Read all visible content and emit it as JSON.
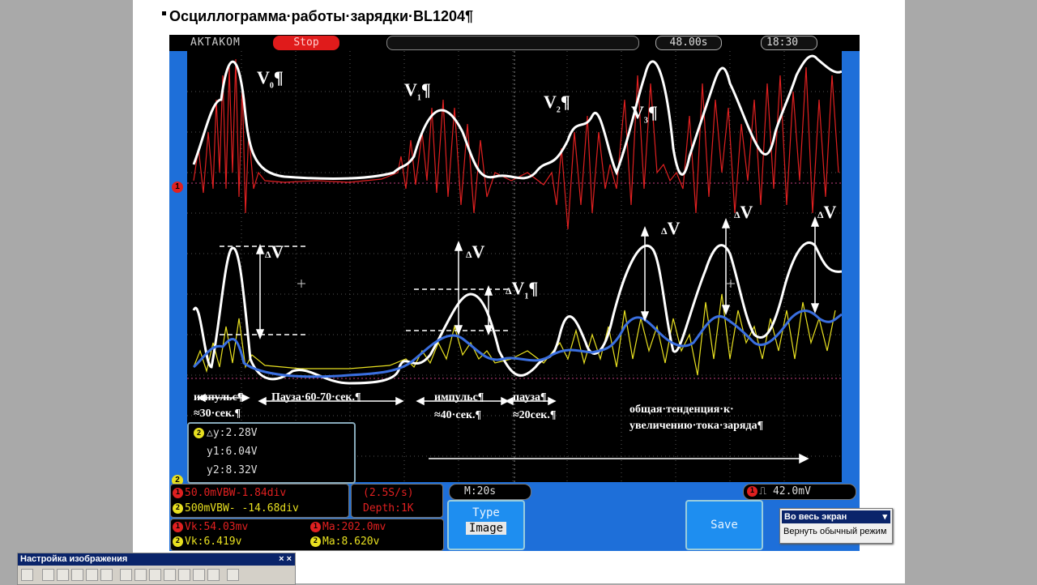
{
  "document": {
    "heading": "Осциллограмма·работы·зарядки·BL1204¶"
  },
  "scope": {
    "brand": "AKTAKOM",
    "run_state": "Stop",
    "timer": "48.00s",
    "clock": "18:30",
    "channel1_marker": "1",
    "channel2_marker": "2",
    "cursor": {
      "dy": "△y:2.28V",
      "y1": "y1:6.04V",
      "y2": "y2:8.32V"
    },
    "ch1_scale": "50.0mVBW-1.84div",
    "ch2_scale": "500mVBW- -14.68div",
    "sample_rate": "(2.5S/s)",
    "depth": "Depth:1K",
    "timebase": "M:20s",
    "trigger_level": "42.0mV",
    "vk1": "Vk:54.03mv",
    "vk2": "Vk:6.419v",
    "ma1": "Ma:202.0mv",
    "ma2": "Ma:8.620v",
    "type_label": "Type",
    "type_value": "Image",
    "save_label": "Save"
  },
  "annotations": {
    "v0": "V",
    "v0_sub": "0",
    "v1": "V",
    "v1_sub": "1",
    "v2": "V",
    "v2_sub": "2",
    "v3": "V",
    "v3_sub": "3",
    "pilcrow": "¶",
    "delta": "Δ",
    "dv": "V",
    "dv1": "V",
    "dv1_sub": "1",
    "impulse1": "импульс¶",
    "impulse1_time": "≈30·сек.¶",
    "pause1": "Пауза·60-70·сек.¶",
    "impulse2": "импульс¶",
    "impulse2_time": "≈40·сек.¶",
    "pause2": "пауза¶",
    "pause2_time": "≈20сек.¶",
    "trend1": "общая·тенденция·к·",
    "trend2": "увеличению·тока·заряда¶"
  },
  "context_menu": {
    "title": "Во весь экран",
    "item": "Вернуть обычный режим"
  },
  "picture_toolbar": {
    "title": "Настройка изображения",
    "close": "× ×"
  },
  "colors": {
    "scope_frame": "#1e6fd9",
    "ch1": "#e02020",
    "ch2": "#e8e020",
    "trend_white": "#ffffff",
    "trend_blue": "#3a6fe0"
  }
}
